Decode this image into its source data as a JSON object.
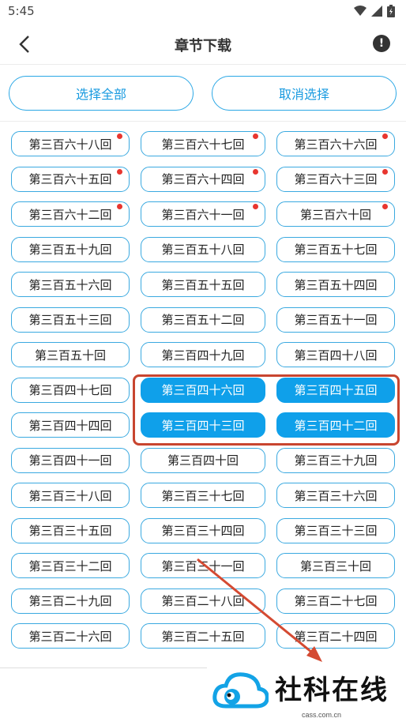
{
  "status": {
    "time": "5:45"
  },
  "header": {
    "title": "章节下载",
    "info": "!"
  },
  "actions": {
    "select_all": "选择全部",
    "cancel": "取消选择"
  },
  "chapters": [
    {
      "label": "第三百六十八回",
      "dot": true,
      "selected": false
    },
    {
      "label": "第三百六十七回",
      "dot": true,
      "selected": false
    },
    {
      "label": "第三百六十六回",
      "dot": true,
      "selected": false
    },
    {
      "label": "第三百六十五回",
      "dot": true,
      "selected": false
    },
    {
      "label": "第三百六十四回",
      "dot": true,
      "selected": false
    },
    {
      "label": "第三百六十三回",
      "dot": true,
      "selected": false
    },
    {
      "label": "第三百六十二回",
      "dot": true,
      "selected": false
    },
    {
      "label": "第三百六十一回",
      "dot": true,
      "selected": false
    },
    {
      "label": "第三百六十回",
      "dot": true,
      "selected": false
    },
    {
      "label": "第三百五十九回",
      "dot": false,
      "selected": false
    },
    {
      "label": "第三百五十八回",
      "dot": false,
      "selected": false
    },
    {
      "label": "第三百五十七回",
      "dot": false,
      "selected": false
    },
    {
      "label": "第三百五十六回",
      "dot": false,
      "selected": false
    },
    {
      "label": "第三百五十五回",
      "dot": false,
      "selected": false
    },
    {
      "label": "第三百五十四回",
      "dot": false,
      "selected": false
    },
    {
      "label": "第三百五十三回",
      "dot": false,
      "selected": false
    },
    {
      "label": "第三百五十二回",
      "dot": false,
      "selected": false
    },
    {
      "label": "第三百五十一回",
      "dot": false,
      "selected": false
    },
    {
      "label": "第三百五十回",
      "dot": false,
      "selected": false
    },
    {
      "label": "第三百四十九回",
      "dot": false,
      "selected": false
    },
    {
      "label": "第三百四十八回",
      "dot": false,
      "selected": false
    },
    {
      "label": "第三百四十七回",
      "dot": false,
      "selected": false
    },
    {
      "label": "第三百四十六回",
      "dot": false,
      "selected": true
    },
    {
      "label": "第三百四十五回",
      "dot": false,
      "selected": true
    },
    {
      "label": "第三百四十四回",
      "dot": false,
      "selected": false
    },
    {
      "label": "第三百四十三回",
      "dot": false,
      "selected": true
    },
    {
      "label": "第三百四十二回",
      "dot": false,
      "selected": true
    },
    {
      "label": "第三百四十一回",
      "dot": false,
      "selected": false
    },
    {
      "label": "第三百四十回",
      "dot": false,
      "selected": false
    },
    {
      "label": "第三百三十九回",
      "dot": false,
      "selected": false
    },
    {
      "label": "第三百三十八回",
      "dot": false,
      "selected": false
    },
    {
      "label": "第三百三十七回",
      "dot": false,
      "selected": false
    },
    {
      "label": "第三百三十六回",
      "dot": false,
      "selected": false
    },
    {
      "label": "第三百三十五回",
      "dot": false,
      "selected": false
    },
    {
      "label": "第三百三十四回",
      "dot": false,
      "selected": false
    },
    {
      "label": "第三百三十三回",
      "dot": false,
      "selected": false
    },
    {
      "label": "第三百三十二回",
      "dot": false,
      "selected": false
    },
    {
      "label": "第三百三十一回",
      "dot": false,
      "selected": false
    },
    {
      "label": "第三百三十回",
      "dot": false,
      "selected": false
    },
    {
      "label": "第三百二十九回",
      "dot": false,
      "selected": false
    },
    {
      "label": "第三百二十八回",
      "dot": false,
      "selected": false
    },
    {
      "label": "第三百二十七回",
      "dot": false,
      "selected": false
    },
    {
      "label": "第三百二十六回",
      "dot": false,
      "selected": false
    },
    {
      "label": "第三百二十五回",
      "dot": false,
      "selected": false
    },
    {
      "label": "第三百二十四回",
      "dot": false,
      "selected": false
    }
  ],
  "watermark": {
    "name": "社科在线",
    "site": "cass.com.cn"
  },
  "colors": {
    "accent": "#0fa0ea",
    "annotation": "#c8452f",
    "dot": "#e8362f"
  }
}
